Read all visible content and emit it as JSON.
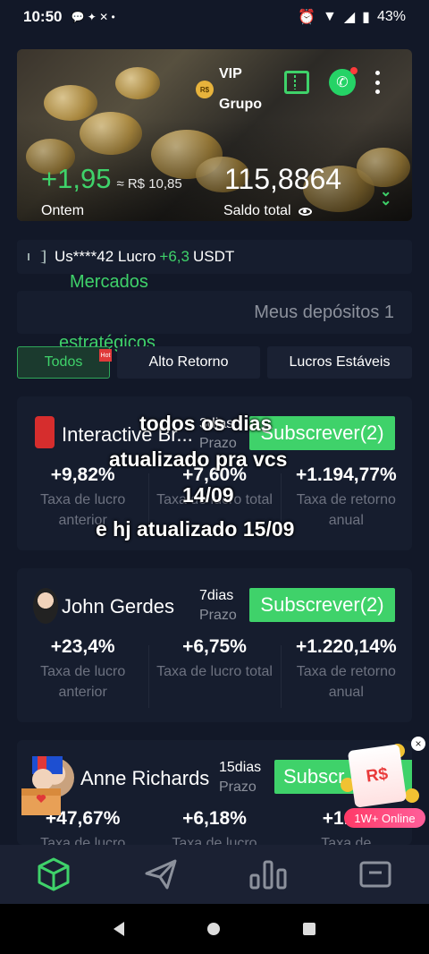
{
  "statusbar": {
    "time": "10:50",
    "battery": "43%"
  },
  "header": {
    "vip_badge": "R$",
    "vip_line1": "VIP",
    "vip_line2": "Grupo",
    "profit_value": "+1,95",
    "profit_converted": "≈ R$ 10,85",
    "profit_label": "Ontem",
    "balance_value": "115,8864",
    "balance_label": "Saldo total"
  },
  "notice": {
    "user": "Us****42 Lucro",
    "amount": "+6,3",
    "currency": "USDT"
  },
  "overlay_text": {
    "line1": "Mercados",
    "line2": "estratégicos"
  },
  "deposits_label": "Meus depósitos 1",
  "tabs": [
    {
      "label": "Todos"
    },
    {
      "label": "Alto Retorno"
    },
    {
      "label": "Lucros Estáveis"
    }
  ],
  "hot_badge": "Hot",
  "cards": [
    {
      "name": "Interactive Br...",
      "days": "3dias",
      "prazo": "Prazo",
      "subscribe": "Subscrever(2)",
      "stats": [
        {
          "value": "+9,82%",
          "label": "Taxa de lucro anterior"
        },
        {
          "value": "+7,60%",
          "label": "Taxa de lucro total"
        },
        {
          "value": "+1.194,77%",
          "label": "Taxa de retorno anual"
        }
      ]
    },
    {
      "name": "John Gerdes",
      "days": "7dias",
      "prazo": "Prazo",
      "subscribe": "Subscrever(2)",
      "stats": [
        {
          "value": "+23,4%",
          "label": "Taxa de lucro anterior"
        },
        {
          "value": "+6,75%",
          "label": "Taxa de lucro total"
        },
        {
          "value": "+1.220,14%",
          "label": "Taxa de retorno anual"
        }
      ]
    },
    {
      "name": "Anne Richards",
      "days": "15dias",
      "prazo": "Prazo",
      "subscribe": "Subscr",
      "stats": [
        {
          "value": "+47,67%",
          "label": "Taxa de lucro"
        },
        {
          "value": "+6,18%",
          "label": "Taxa de lucro"
        },
        {
          "value": "+1.15",
          "label": "Taxa de"
        }
      ]
    }
  ],
  "caption": {
    "line1": "todos os dias",
    "line2": "atualizado pra vcs",
    "line3": "14/09",
    "line4": "e hj atualizado 15/09"
  },
  "promo": {
    "badge": "R$",
    "pill": "1W+ Online",
    "close": "×"
  },
  "bottom_nav": [
    {
      "icon": "cube-icon"
    },
    {
      "icon": "send-icon"
    },
    {
      "icon": "bar-chart-icon"
    },
    {
      "icon": "wallet-icon"
    }
  ],
  "colors": {
    "accent": "#3fd26a",
    "background": "#121828",
    "card": "#161d2e"
  }
}
